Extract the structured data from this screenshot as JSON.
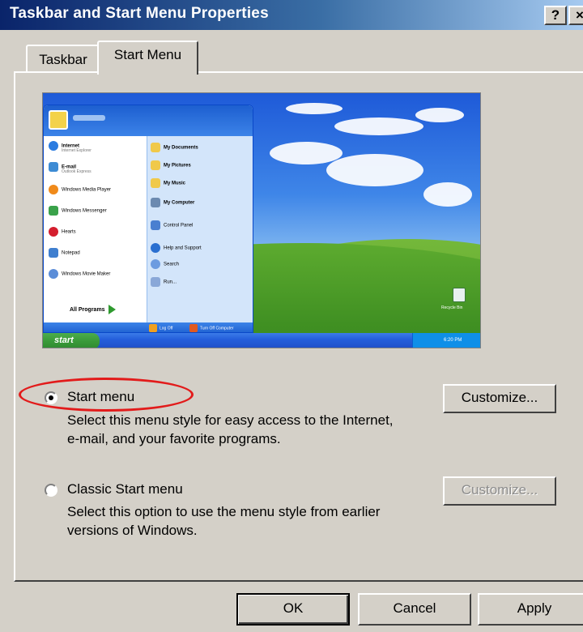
{
  "window": {
    "title": "Taskbar and Start Menu Properties",
    "help_glyph": "?",
    "close_glyph": "×"
  },
  "tabs": [
    {
      "label": "Taskbar",
      "selected": false
    },
    {
      "label": "Start Menu",
      "selected": true
    }
  ],
  "options": {
    "start_menu": {
      "label": "Start menu",
      "checked": true,
      "description": "Select this menu style for easy access to the Internet, e-mail, and your favorite programs.",
      "customize_label": "Customize...",
      "customize_enabled": true
    },
    "classic_menu": {
      "label": "Classic Start menu",
      "checked": false,
      "description": "Select this option to use the menu style from earlier versions of Windows.",
      "customize_label": "Customize...",
      "customize_enabled": false
    }
  },
  "preview": {
    "left_items": [
      {
        "name": "Internet",
        "sub": "Internet Explorer",
        "icon": "internet-explorer-icon"
      },
      {
        "name": "E-mail",
        "sub": "Outlook Express",
        "icon": "outlook-express-icon"
      },
      {
        "name": "Windows Media Player",
        "icon": "media-player-icon"
      },
      {
        "name": "Windows Messenger",
        "icon": "messenger-icon"
      },
      {
        "name": "Hearts",
        "icon": "hearts-icon"
      },
      {
        "name": "Notepad",
        "icon": "notepad-icon"
      },
      {
        "name": "Windows Movie Maker",
        "icon": "movie-maker-icon"
      }
    ],
    "all_programs": "All Programs",
    "right_items": [
      {
        "name": "My Documents",
        "icon": "folder-icon"
      },
      {
        "name": "My Pictures",
        "icon": "folder-icon"
      },
      {
        "name": "My Music",
        "icon": "folder-icon"
      },
      {
        "name": "My Computer",
        "icon": "computer-icon"
      },
      {
        "name": "Control Panel",
        "icon": "control-panel-icon"
      },
      {
        "name": "Help and Support",
        "icon": "help-icon"
      },
      {
        "name": "Search",
        "icon": "search-icon"
      },
      {
        "name": "Run...",
        "icon": "run-icon"
      }
    ],
    "log_off": "Log Off",
    "turn_off": "Turn Off Computer",
    "start_button": "start",
    "tray_time": "6:20 PM",
    "recycle_bin": "Recycle Bin"
  },
  "buttons": {
    "ok": "OK",
    "cancel": "Cancel",
    "apply": "Apply"
  },
  "colors": {
    "title_bar": "#0a246a",
    "dialog_face": "#d4d0c8",
    "highlight_ring": "#e21b1b",
    "xp_taskbar": "#245edb",
    "xp_start": "#3a9a3a"
  }
}
